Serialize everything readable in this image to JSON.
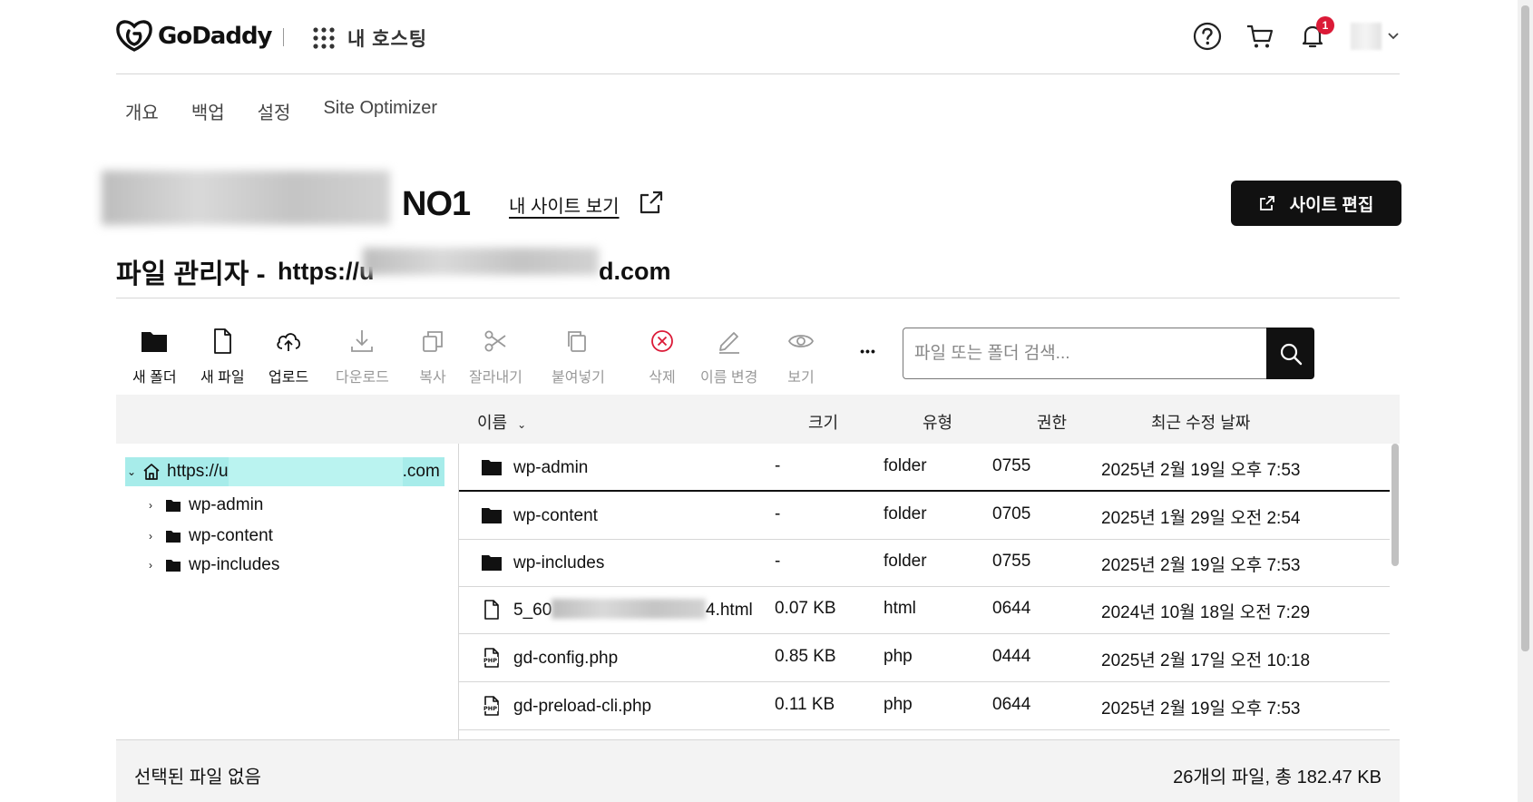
{
  "header": {
    "brand": "GoDaddy",
    "app_title": "내 호스팅",
    "notification_count": "1"
  },
  "nav": {
    "items": [
      "개요",
      "백업",
      "설정",
      "Site Optimizer"
    ]
  },
  "site": {
    "name_visible": "NO1",
    "view_site_label": "내 사이트 보기",
    "edit_site_label": "사이트 편집"
  },
  "file_manager": {
    "title": "파일 관리자 -",
    "url_prefix": "https://",
    "url_mid": "u",
    "url_suffix": "d.com"
  },
  "toolbar": {
    "new_folder": "새 폴더",
    "new_file": "새 파일",
    "upload": "업로드",
    "download": "다운로드",
    "copy": "복사",
    "cut": "잘라내기",
    "paste": "붙여넣기",
    "delete": "삭제",
    "rename": "이름 변경",
    "view": "보기",
    "more": "•••",
    "search_placeholder": "파일 또는 폴더 검색..."
  },
  "table": {
    "columns": {
      "name": "이름",
      "name_sort": "⌄",
      "size": "크기",
      "type": "유형",
      "permissions": "권한",
      "modified": "최근 수정 날짜"
    },
    "rows": [
      {
        "name": "wp-admin",
        "size": "-",
        "type": "folder",
        "perm": "0755",
        "modified": "2025년 2월 19일 오후 7:53",
        "icon": "folder-icon"
      },
      {
        "name": "wp-content",
        "size": "-",
        "type": "folder",
        "perm": "0705",
        "modified": "2025년 1월 29일 오전 2:54",
        "icon": "folder-icon"
      },
      {
        "name": "wp-includes",
        "size": "-",
        "type": "folder",
        "perm": "0755",
        "modified": "2025년 2월 19일 오후 7:53",
        "icon": "folder-icon"
      },
      {
        "name_start": "5_60",
        "name_end": "4.html",
        "size": "0.07 KB",
        "type": "html",
        "perm": "0644",
        "modified": "2024년 10월 18일 오전 7:29",
        "icon": "file-icon"
      },
      {
        "name": "gd-config.php",
        "size": "0.85 KB",
        "type": "php",
        "perm": "0444",
        "modified": "2025년 2월 17일 오전 10:18",
        "icon": "php-file-icon"
      },
      {
        "name": "gd-preload-cli.php",
        "size": "0.11 KB",
        "type": "php",
        "perm": "0644",
        "modified": "2025년 2월 19일 오후 7:53",
        "icon": "php-file-icon"
      }
    ]
  },
  "tree": {
    "root_prefix": "https://",
    "root_mid": "u",
    "root_suffix": ".com",
    "children": [
      "wp-admin",
      "wp-content",
      "wp-includes"
    ]
  },
  "footer": {
    "selection": "선택된 파일 없음",
    "summary": "26개의 파일, 총 182.47 KB"
  },
  "colors": {
    "accent_dark": "#111111",
    "tree_highlight": "#a7ecea",
    "notification": "#db1a37",
    "delete_icon": "#db1a37"
  }
}
